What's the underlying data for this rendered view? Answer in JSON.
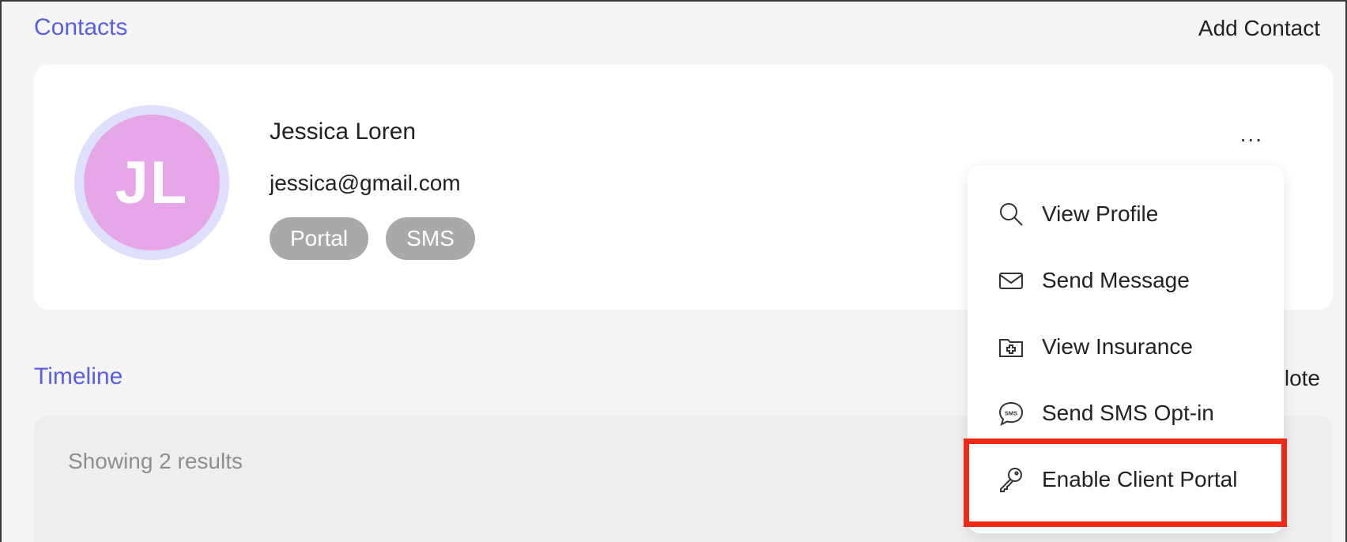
{
  "contacts": {
    "title": "Contacts",
    "add_label": "Add Contact",
    "contact": {
      "initials": "JL",
      "name": "Jessica Loren",
      "email": "jessica@gmail.com",
      "tags": [
        "Portal",
        "SMS"
      ],
      "more_label": "..."
    }
  },
  "timeline": {
    "title": "Timeline",
    "action_partial": "lote",
    "results_text": "Showing 2 results"
  },
  "menu": {
    "items": [
      {
        "label": "View Profile",
        "icon": "search-icon"
      },
      {
        "label": "Send Message",
        "icon": "envelope-icon"
      },
      {
        "label": "View Insurance",
        "icon": "medical-folder-icon"
      },
      {
        "label": "Send SMS Opt-in",
        "icon": "sms-bubble-icon"
      },
      {
        "label": "Enable Client Portal",
        "icon": "key-icon"
      }
    ]
  },
  "colors": {
    "accent": "#5a5fe0",
    "avatar_bg": "#e6a6e8",
    "avatar_ring": "#dfe0fb",
    "tag_bg": "#a9a9a9",
    "highlight": "#ee2a17"
  }
}
